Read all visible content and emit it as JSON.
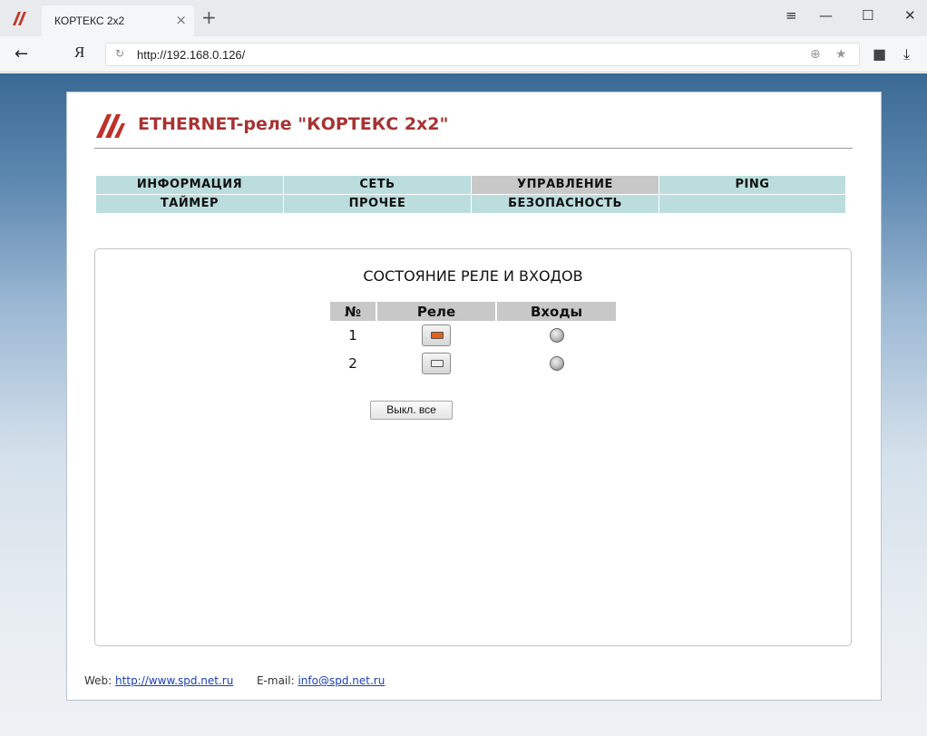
{
  "browser": {
    "tab_title": "КОРТЕКС 2x2",
    "tab_close": "×",
    "new_tab": "+",
    "url": "http://192.168.0.126/",
    "yandex_button": "Я",
    "back_icon": "←",
    "window_controls": {
      "menu": "≡",
      "minimize": "—",
      "maximize": "☐",
      "close": "✕"
    }
  },
  "header": {
    "title": "ETHERNET-реле \"КОРТЕКС 2x2\"",
    "brand_color": "#a83232"
  },
  "menu": {
    "row1": [
      "ИНФОРМАЦИЯ",
      "СЕТЬ",
      "УПРАВЛЕНИЕ",
      "PING"
    ],
    "row2": [
      "ТАЙМЕР",
      "ПРОЧЕЕ",
      "БЕЗОПАСНОСТЬ",
      ""
    ],
    "active": "УПРАВЛЕНИЕ"
  },
  "panel": {
    "title": "СОСТОЯНИЕ РЕЛЕ И ВХОДОВ",
    "columns": [
      "№",
      "Реле",
      "Входы"
    ],
    "rows": [
      {
        "num": "1",
        "relay_on": true,
        "input_on": false
      },
      {
        "num": "2",
        "relay_on": false,
        "input_on": false
      }
    ],
    "relay_on_color": "#e2601c",
    "relay_off_color": "#f0f0f0",
    "off_all_button": "Выкл. все"
  },
  "footer": {
    "web_label": "Web:",
    "web_link": "http://www.spd.net.ru",
    "email_label": "E-mail:",
    "email_link": "info@spd.net.ru"
  }
}
